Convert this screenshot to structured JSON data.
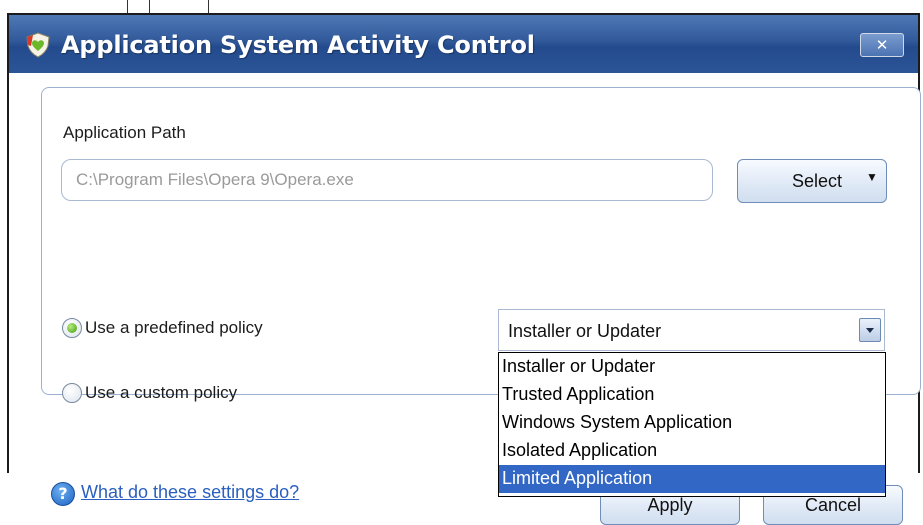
{
  "window": {
    "title": "Application System Activity Control",
    "close_label": "✕",
    "icon": "shield-heart-icon"
  },
  "form": {
    "path_label": "Application Path",
    "path_value": "C:\\Program Files\\Opera 9\\Opera.exe",
    "select_label": "Select",
    "radio_predefined": {
      "label": "Use a predefined policy",
      "checked": true
    },
    "radio_custom": {
      "label": "Use a custom policy",
      "checked": false
    },
    "policy_selected": "Installer or Updater",
    "policy_options": [
      "Installer or Updater",
      "Trusted Application",
      "Windows System Application",
      "Isolated Application",
      "Limited Application"
    ],
    "highlighted_option": "Limited Application"
  },
  "footer": {
    "help_link": "What do these settings do?",
    "apply_label": "Apply",
    "cancel_label": "Cancel"
  },
  "colors": {
    "titlebar": "#31599a",
    "selection": "#3267c5",
    "link": "#2a5fbf"
  }
}
